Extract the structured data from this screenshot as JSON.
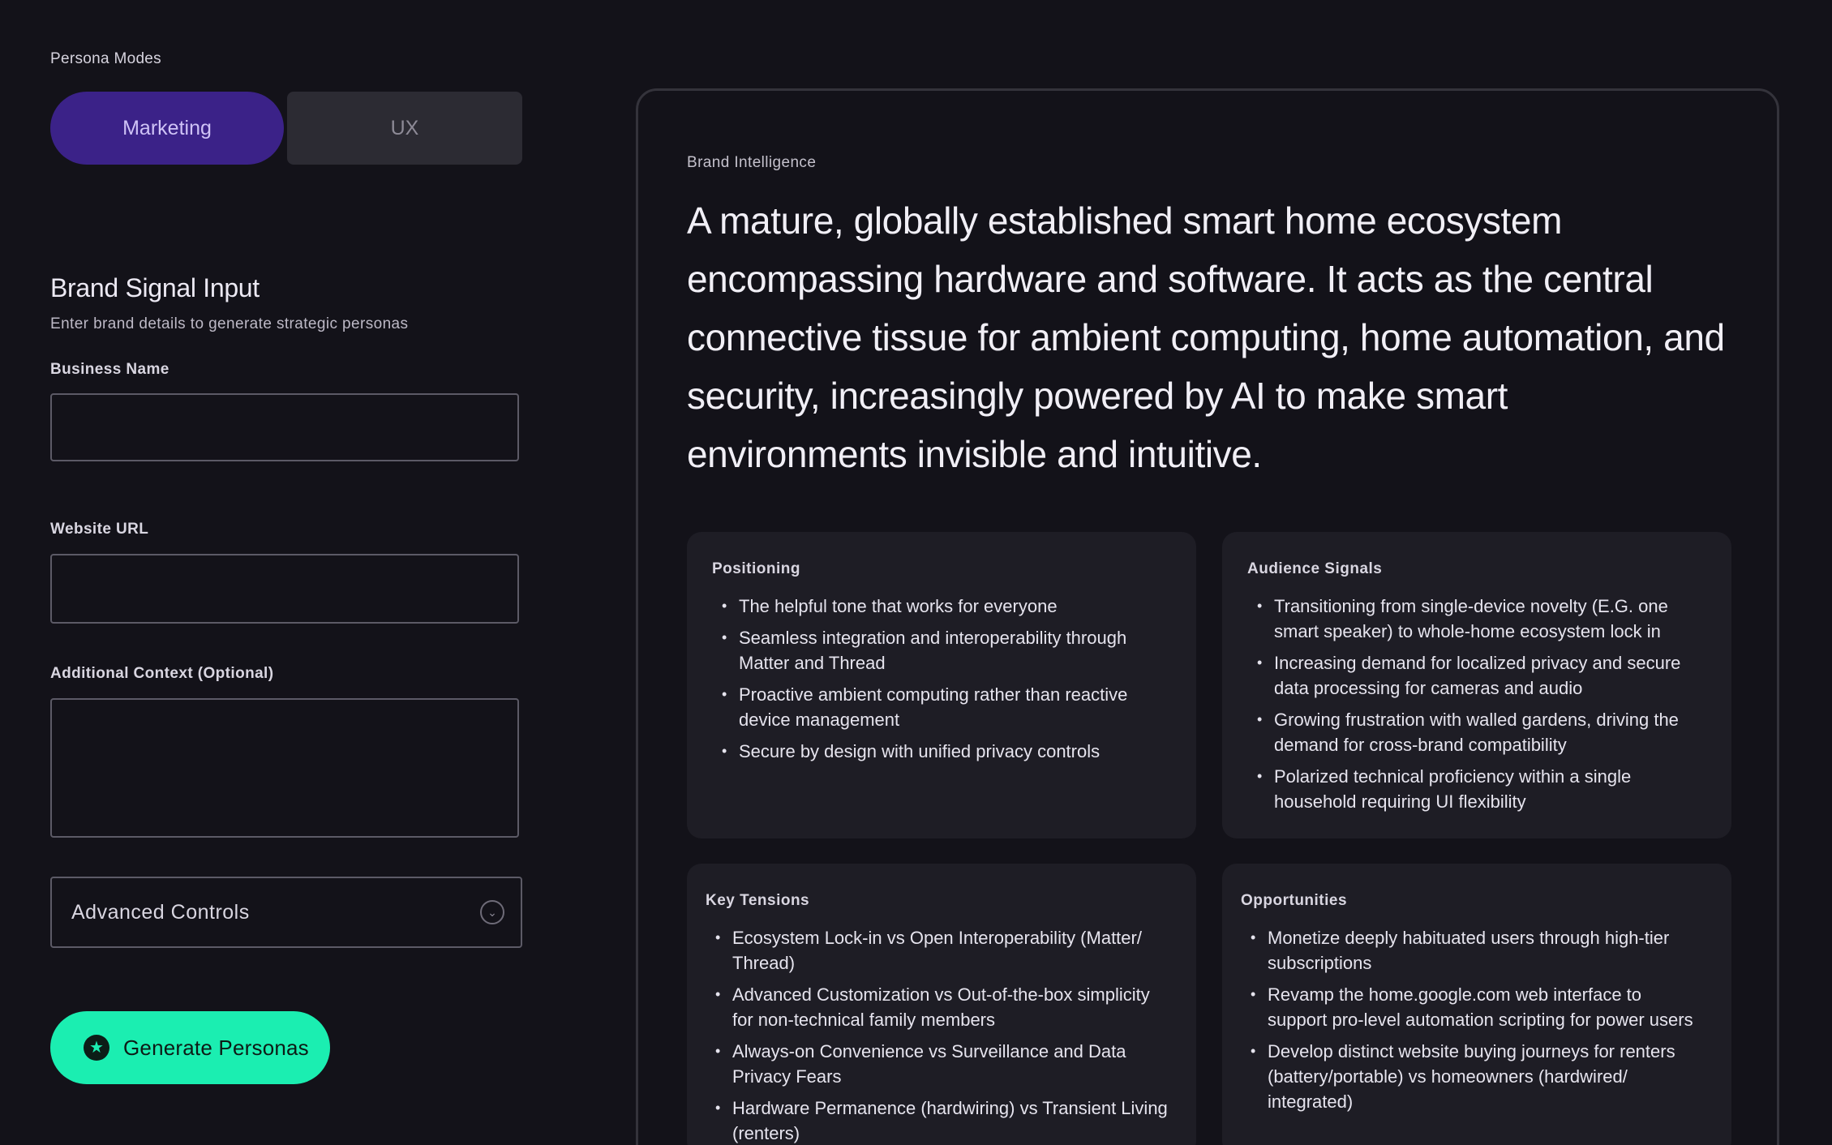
{
  "persona_modes": {
    "label": "Persona Modes",
    "options": [
      "Marketing",
      "UX"
    ],
    "selected": "Marketing"
  },
  "brand_input": {
    "title": "Brand Signal Input",
    "subtitle": "Enter brand details to generate strategic personas",
    "business_name": {
      "label": "Business Name",
      "value": ""
    },
    "website_url": {
      "label": "Website URL",
      "value": ""
    },
    "additional_context": {
      "label": "Additional Context (Optional)",
      "value": ""
    },
    "advanced_controls": "Advanced Controls",
    "generate_button": "Generate Personas"
  },
  "brand_intelligence": {
    "label": "Brand Intelligence",
    "description": "A mature, globally established smart home ecosystem encompassing hardware and software. It acts as the central connective tissue for ambient computing, home automation, and security, increasingly powered by AI to make smart environments invisible and intuitive.",
    "positioning": {
      "title": "Positioning",
      "items": [
        "The helpful tone that works for everyone",
        "Seamless integration and interoperability through Matter and Thread",
        "Proactive ambient computing rather than reactive device management",
        "Secure by design with unified privacy controls"
      ]
    },
    "audience_signals": {
      "title": "Audience Signals",
      "items": [
        "Transitioning from single-device novelty (E.G. one smart speaker) to whole-home ecosystem lock in",
        "Increasing demand for localized privacy and secure data processing for cameras and audio",
        "Growing frustration with walled gardens, driving the demand for cross-brand compatibility",
        "Polarized technical proficiency within a single household requiring UI flexibility"
      ]
    },
    "key_tensions": {
      "title": "Key Tensions",
      "items": [
        "Ecosystem Lock-in vs Open Interoperability (Matter/ Thread)",
        "Advanced Customization vs Out-of-the-box simplicity for non-technical family members",
        "Always-on Convenience vs Surveillance and Data Privacy Fears",
        "Hardware Permanence (hardwiring) vs Transient Living (renters)"
      ]
    },
    "opportunities": {
      "title": "Opportunities",
      "items": [
        "Monetize deeply habituated users through high-tier subscriptions",
        "Revamp the home.google.com web interface to support pro-level automation scripting for power users",
        "Develop distinct website buying journeys for renters (battery/portable) vs homeowners (hardwired/ integrated)"
      ]
    }
  },
  "colors": {
    "background": "#131219",
    "accent_purple": "#3b2288",
    "accent_green": "#1beeb1",
    "card_surface": "#1e1d25"
  }
}
